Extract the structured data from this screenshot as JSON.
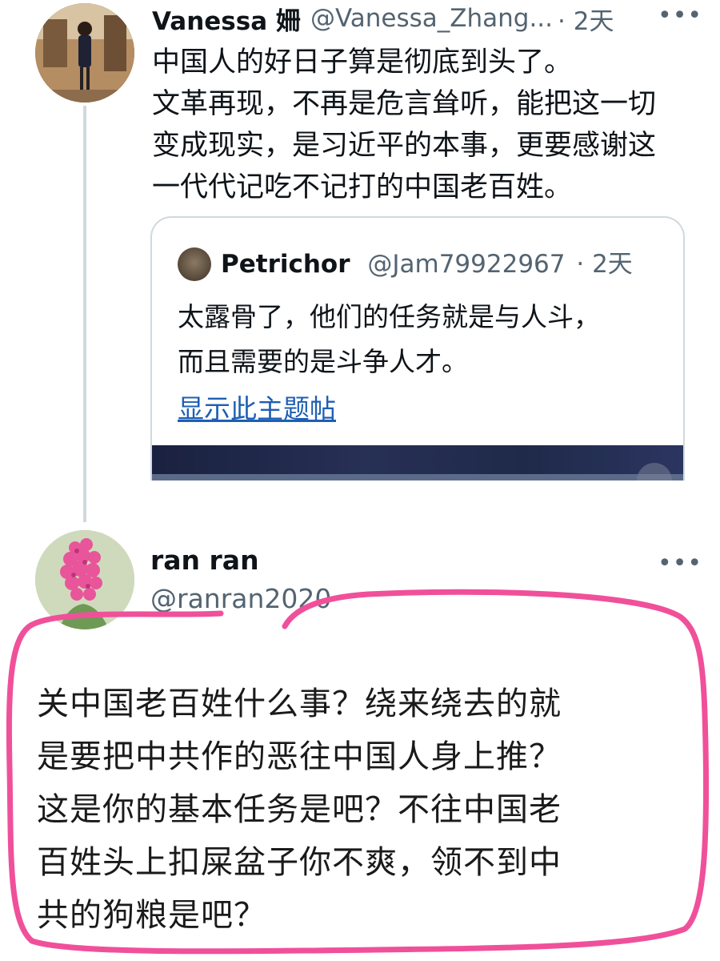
{
  "tweet1": {
    "name": "Vanessa 姍",
    "handle": "@Vanessa_Zhang...",
    "time": "· 2天",
    "lines": [
      "中国人的好日子算是彻底到头了。",
      "文革再现，不再是危言耸听，能把这一切",
      "变成现实，是习近平的本事，更要感谢这",
      "一代代记吃不记打的中国老百姓。"
    ],
    "more_icon": "•••"
  },
  "quote": {
    "name": "Petrichor",
    "handle": "@Jam79922967",
    "time": "· 2天",
    "lines": [
      "太露骨了，他们的任务就是与人斗，",
      "而且需要的是斗争人才。"
    ],
    "link": "显示此主题帖"
  },
  "tweet2": {
    "name": "ran ran",
    "handle": "@ranran2020",
    "lines": [
      "关中国老百姓什么事？绕来绕去的就",
      "是要把中共作的恶往中国人身上推？",
      "这是你的基本任务是吧？不往中国老",
      "百姓头上扣屎盆子你不爽，领不到中",
      "共的狗粮是吧？"
    ],
    "more_icon": "•••"
  },
  "colors": {
    "annotation": "#f0509a",
    "link": "#1d5fb4",
    "secondary_text": "#536471"
  }
}
